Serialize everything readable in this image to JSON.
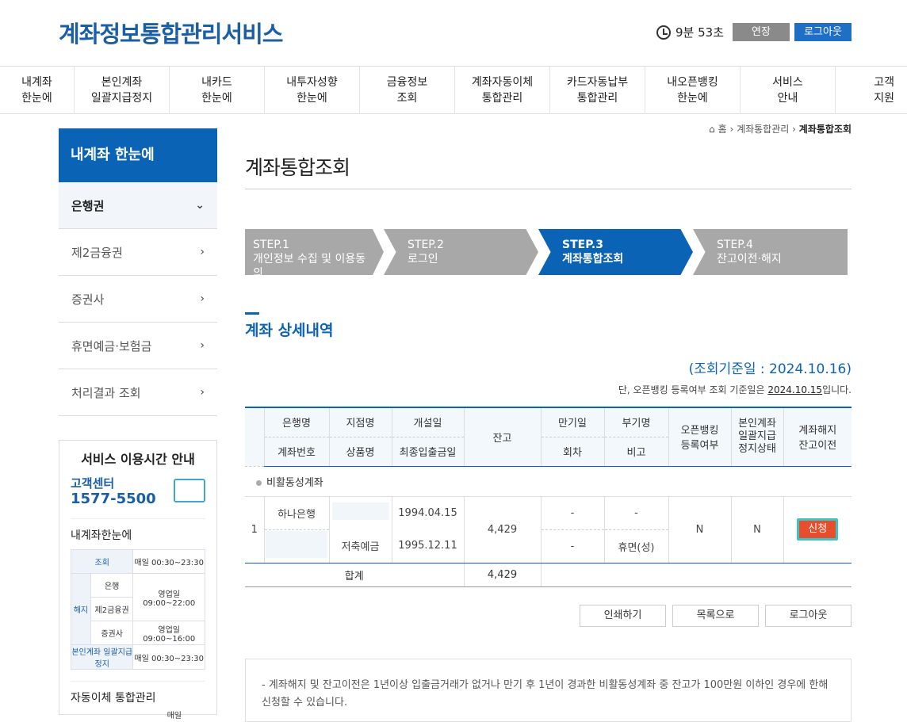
{
  "header": {
    "logo": "계좌정보통합관리서비스",
    "timer": "9분 53초",
    "extend_label": "연장",
    "logout_label": "로그아웃"
  },
  "gnb": [
    {
      "label": "내계좌\n한눈에"
    },
    {
      "label": "본인계좌\n일괄지급정지"
    },
    {
      "label": "내카드\n한눈에"
    },
    {
      "label": "내투자성향\n한눈에"
    },
    {
      "label": "금융정보\n조회"
    },
    {
      "label": "계좌자동이체\n통합관리"
    },
    {
      "label": "카드자동납부\n통합관리"
    },
    {
      "label": "내오픈뱅킹\n한눈에"
    },
    {
      "label": "서비스\n안내"
    },
    {
      "label": "고객\n지원"
    }
  ],
  "lnb": {
    "title": "내계좌 한눈에",
    "items": [
      {
        "label": "은행권"
      },
      {
        "label": "제2금융권"
      },
      {
        "label": "증권사"
      },
      {
        "label": "휴면예금·보험금"
      },
      {
        "label": "처리결과 조회"
      }
    ]
  },
  "service": {
    "title": "서비스 이용시간 안내",
    "cs_label": "고객센터",
    "cs_phone": "1577-5500",
    "section1": "내계좌한눈에",
    "table": {
      "lookup": "조회",
      "lookup_time": "매일 00:30~23:30",
      "cancel": "해지",
      "bank": "은행",
      "bank_time": "영업일 09:00~22:00",
      "second": "제2금융권",
      "sec": "증권사",
      "sec_time": "영업일 09:00~16:00",
      "stop": "본인계좌 일괄지급정지",
      "stop_time": "매일 00:30~23:30"
    },
    "section2": "자동이체 통합관리",
    "section2_time": "매일"
  },
  "breadcrumb": {
    "home": "홈",
    "mid": "계좌통합관리",
    "current": "계좌통합조회"
  },
  "page_title": "계좌통합조회",
  "steps": [
    {
      "step": "STEP.1",
      "label": "개인정보 수집 및 이용동의"
    },
    {
      "step": "STEP.2",
      "label": "로그인"
    },
    {
      "step": "STEP.3",
      "label": "계좌통합조회"
    },
    {
      "step": "STEP.4",
      "label": "잔고이전·해지"
    }
  ],
  "section_title": "계좌 상세내역",
  "ref_date": "(조회기준일 : 2024.10.16)",
  "note_prefix": "단, 오픈뱅킹 등록여부 조회 기준일은 ",
  "note_date": "2024.10.15",
  "note_suffix": "입니다.",
  "table": {
    "h_bank": "은행명",
    "h_branch": "지점명",
    "h_open": "개설일",
    "h_balance": "잔고",
    "h_maturity": "만기일",
    "h_sub": "부기명",
    "h_ob": "오픈뱅킹\n등록여부",
    "h_stop": "본인계좌\n일괄지급\n정지상태",
    "h_close": "계좌해지\n잔고이전",
    "h_acct": "계좌번호",
    "h_product": "상품명",
    "h_last": "최종입출금일",
    "h_round": "회차",
    "h_memo": "비고",
    "group": "비활동성계좌",
    "row": {
      "no": "1",
      "bank": "하나은행",
      "open": "1994.04.15",
      "product": "저축예금",
      "last": "1995.12.11",
      "balance": "4,429",
      "maturity": "-",
      "sub": "-",
      "round": "-",
      "memo": "휴면(성)",
      "ob": "N",
      "stop": "N",
      "apply": "신청"
    },
    "total_label": "합계",
    "total_value": "4,429"
  },
  "buttons": {
    "print": "인쇄하기",
    "list": "목록으로",
    "logout": "로그아웃"
  },
  "info": "- 계좌해지 및 잔고이전은 1년이상 입출금거래가 없거나 만기 후 1년이 경과한 비활동성계좌 중 잔고가 100만원 이하인 경우에 한해 신청할 수 있습니다."
}
